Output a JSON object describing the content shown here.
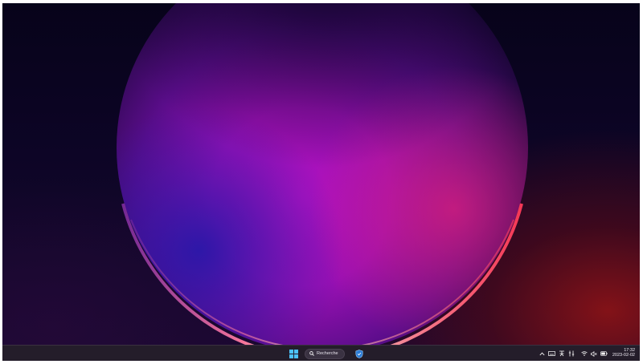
{
  "desktop": {
    "wallpaper": "windows-11-bloom-dark"
  },
  "taskbar": {
    "start_icon": "windows-logo-icon",
    "search": {
      "label": "Recherche",
      "icon": "search-icon"
    },
    "pinned_apps": [
      {
        "name": "security-shield-app",
        "icon": "shield-icon"
      }
    ],
    "tray": {
      "overflow_icon": "chevron-up-icon",
      "keyboard_icon": "keyboard-icon",
      "input_method_icon": "input-method-icon",
      "pen_icon": "pen-menu-icon",
      "wifi_icon": "wifi-icon",
      "volume_icon": "volume-muted-icon",
      "battery_icon": "battery-icon"
    },
    "clock": {
      "time": "17:32",
      "date": "2023-02-02"
    }
  },
  "colors": {
    "taskbar_bg": "#241d2a",
    "accent_blue": "#4cc2ff"
  }
}
